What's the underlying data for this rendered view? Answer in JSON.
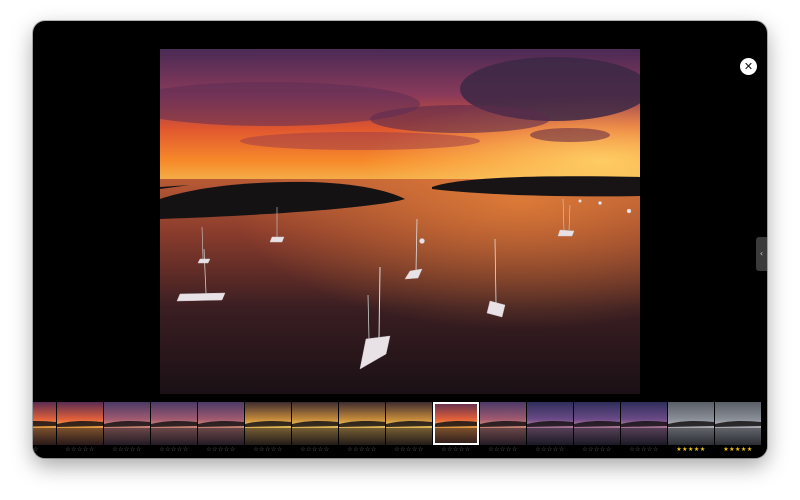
{
  "controls": {
    "close_icon": "close-icon",
    "close_glyph": "✕",
    "side_tab_icon": "chevron-left-icon",
    "side_tab_glyph": "‹"
  },
  "colors": {
    "window_bg": "#000000",
    "rating_empty": "#6a6a6a",
    "rating_filled": "#f0c419",
    "selection_border": "#ffffff"
  },
  "filmstrip": {
    "selected_index": 9,
    "thumbnails": [
      {
        "palette": "sunset",
        "rating": "☆☆",
        "rating_value": 0
      },
      {
        "palette": "sunset",
        "rating": "☆☆☆☆☆",
        "rating_value": 0
      },
      {
        "palette": "dusk",
        "rating": "☆☆☆☆☆",
        "rating_value": 0
      },
      {
        "palette": "dusk",
        "rating": "☆☆☆☆☆",
        "rating_value": 0
      },
      {
        "palette": "dusk",
        "rating": "☆☆☆☆☆",
        "rating_value": 0
      },
      {
        "palette": "golden",
        "rating": "☆☆☆☆☆",
        "rating_value": 0
      },
      {
        "palette": "golden",
        "rating": "☆☆☆☆☆",
        "rating_value": 0
      },
      {
        "palette": "golden",
        "rating": "☆☆☆☆☆",
        "rating_value": 0
      },
      {
        "palette": "golden",
        "rating": "☆☆☆☆☆",
        "rating_value": 0
      },
      {
        "palette": "sunset",
        "rating": "☆☆☆☆☆",
        "rating_value": 0
      },
      {
        "palette": "dusk",
        "rating": "☆☆☆☆☆",
        "rating_value": 0
      },
      {
        "palette": "purple",
        "rating": "☆☆☆☆☆",
        "rating_value": 0
      },
      {
        "palette": "purple",
        "rating": "☆☆☆☆☆",
        "rating_value": 0
      },
      {
        "palette": "purple",
        "rating": "☆☆☆☆☆",
        "rating_value": 0
      },
      {
        "palette": "grey",
        "rating": "★★★★★",
        "rating_value": 5
      },
      {
        "palette": "grey",
        "rating": "★★★★★",
        "rating_value": 5
      }
    ]
  }
}
